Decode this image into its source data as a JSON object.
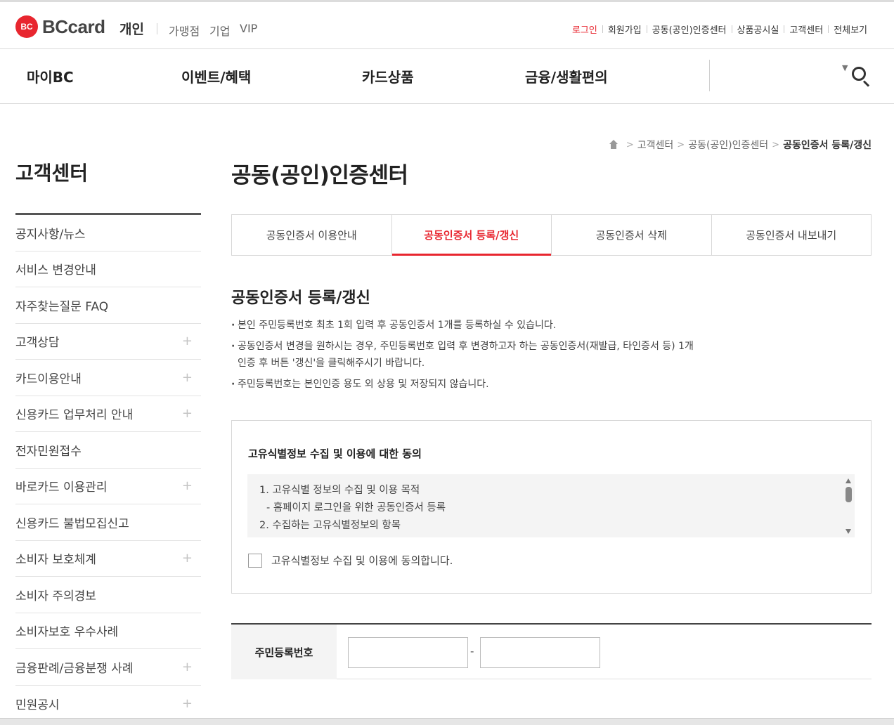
{
  "header": {
    "brand": "BCcard",
    "logo_mark": "BC",
    "personal": "개인",
    "segments": [
      "가맹점",
      "기업",
      "VIP"
    ],
    "utility": {
      "login": "로그인",
      "signup": "회원가입",
      "cert_center": "공동(공인)인증센터",
      "product_notice": "상품공시실",
      "customer_center": "고객센터",
      "view_all": "전체보기"
    }
  },
  "gnb": {
    "items": [
      "마이BC",
      "이벤트/혜택",
      "카드상품",
      "금융/생활편의"
    ],
    "search_icon": "search-icon"
  },
  "sidebar": {
    "title": "고객센터",
    "items": [
      {
        "label": "공지사항/뉴스",
        "expandable": false
      },
      {
        "label": "서비스 변경안내",
        "expandable": false
      },
      {
        "label": "자주찾는질문 FAQ",
        "expandable": false
      },
      {
        "label": "고객상담",
        "expandable": true
      },
      {
        "label": "카드이용안내",
        "expandable": true
      },
      {
        "label": "신용카드 업무처리 안내",
        "expandable": true
      },
      {
        "label": "전자민원접수",
        "expandable": false
      },
      {
        "label": "바로카드 이용관리",
        "expandable": true
      },
      {
        "label": "신용카드 불법모집신고",
        "expandable": false
      },
      {
        "label": "소비자 보호체계",
        "expandable": true
      },
      {
        "label": "소비자 주의경보",
        "expandable": false
      },
      {
        "label": "소비자보호 우수사례",
        "expandable": false
      },
      {
        "label": "금융판례/금융분쟁 사례",
        "expandable": true
      },
      {
        "label": "민원공시",
        "expandable": true
      }
    ],
    "plus_glyph": "+"
  },
  "breadcrumb": {
    "items": [
      "고객센터",
      "공동(공인)인증센터",
      "공동인증서 등록/갱신"
    ],
    "separator": ">"
  },
  "page": {
    "title": "공동(공인)인증센터",
    "tabs": [
      {
        "label": "공동인증서 이용안내",
        "active": false
      },
      {
        "label": "공동인증서 등록/갱신",
        "active": true
      },
      {
        "label": "공동인증서 삭제",
        "active": false
      },
      {
        "label": "공동인증서 내보내기",
        "active": false
      }
    ],
    "section_title": "공동인증서 등록/갱신",
    "notes": [
      "본인 주민등록번호 최초 1회 입력 후 공동인증서 1개를 등록하실 수 있습니다.",
      "공동인증서 변경을 원하시는 경우, 주민등록번호 입력 후 변경하고자 하는 공동인증서(재발급, 타인증서 등) 1개\n인증 후 버튼 '갱신'을 클릭해주시기 바랍니다.",
      "주민등록번호는 본인인증 용도 외 상용 및 저장되지 않습니다."
    ]
  },
  "agreement": {
    "title": "고유식별정보 수집 및 이용에 대한 동의",
    "terms": [
      "1. 고유식별 정보의 수집 및 이용 목적",
      "- 홈페이지 로그인을 위한 공동인증서 등록",
      "2. 수집하는 고유식별정보의 항목"
    ],
    "consent_label": "고유식별정보 수집 및 이용에 동의합니다.",
    "checked": false
  },
  "form": {
    "ssn_label": "주민등록번호",
    "ssn_front": "",
    "ssn_back": "",
    "dash": "-"
  },
  "colors": {
    "accent": "#e8262f",
    "text": "#333333",
    "border": "#d7d7d7",
    "panel": "#f4f4f4"
  }
}
